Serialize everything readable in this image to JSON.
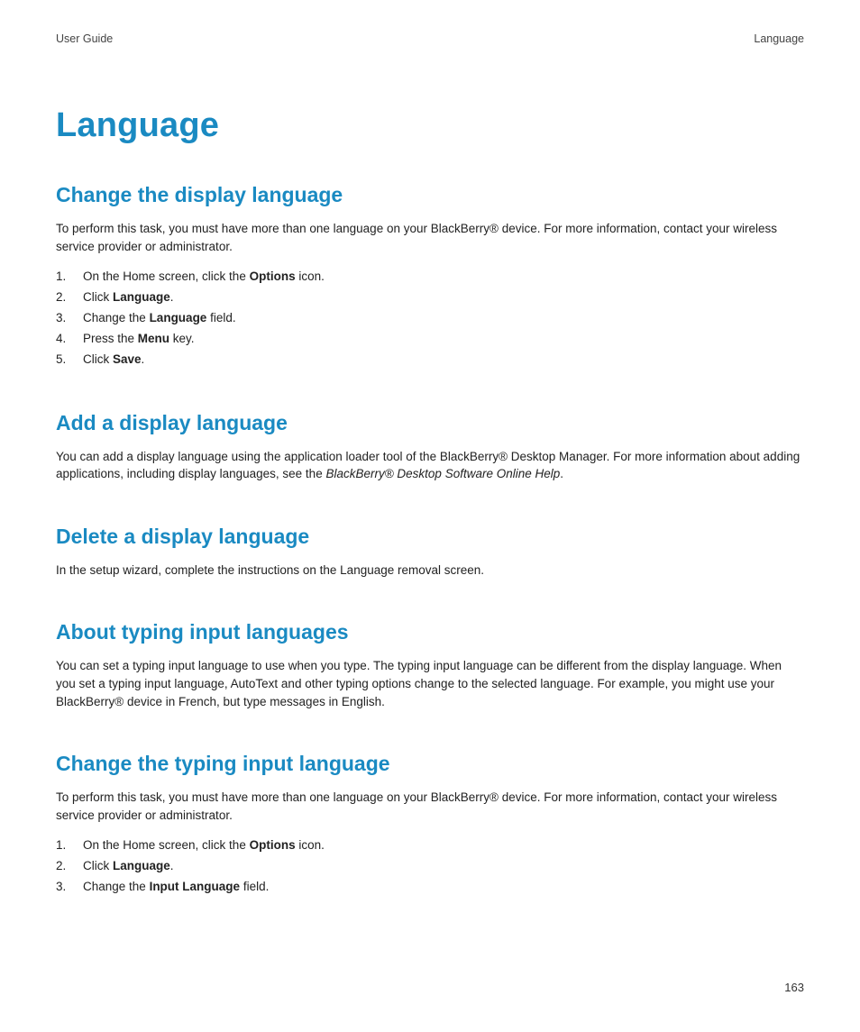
{
  "header": {
    "left": "User Guide",
    "right": "Language"
  },
  "title": "Language",
  "sections": [
    {
      "heading": "Change the display language",
      "intro": "To perform this task, you must have more than one language on your BlackBerry® device. For more information, contact your wireless service provider or administrator.",
      "steps": [
        {
          "pre": "On the Home screen, click the ",
          "bold": "Options",
          "post": " icon."
        },
        {
          "pre": "Click ",
          "bold": "Language",
          "post": "."
        },
        {
          "pre": "Change the ",
          "bold": "Language",
          "post": " field."
        },
        {
          "pre": "Press the ",
          "bold": "Menu",
          "post": " key."
        },
        {
          "pre": "Click ",
          "bold": "Save",
          "post": "."
        }
      ]
    },
    {
      "heading": "Add a display language",
      "intro_pre": "You can add a display language using the application loader tool of the BlackBerry® Desktop Manager. For more information about adding applications, including display languages, see the  ",
      "intro_italic": "BlackBerry® Desktop Software Online Help",
      "intro_post": "."
    },
    {
      "heading": "Delete a display language",
      "intro": "In the setup wizard, complete the instructions on the Language removal screen."
    },
    {
      "heading": "About typing input languages",
      "intro": "You can set a typing input language to use when you type. The typing input language can be different from the display language. When you set a typing input language, AutoText and other typing options change to the selected language. For example, you might use your BlackBerry® device in French, but type messages in English."
    },
    {
      "heading": "Change the typing input language",
      "intro": "To perform this task, you must have more than one language on your BlackBerry® device. For more information, contact your wireless service provider or administrator.",
      "steps": [
        {
          "pre": "On the Home screen, click the ",
          "bold": "Options",
          "post": " icon."
        },
        {
          "pre": "Click ",
          "bold": "Language",
          "post": "."
        },
        {
          "pre": "Change the ",
          "bold": "Input Language",
          "post": " field."
        }
      ]
    }
  ],
  "page_number": "163"
}
